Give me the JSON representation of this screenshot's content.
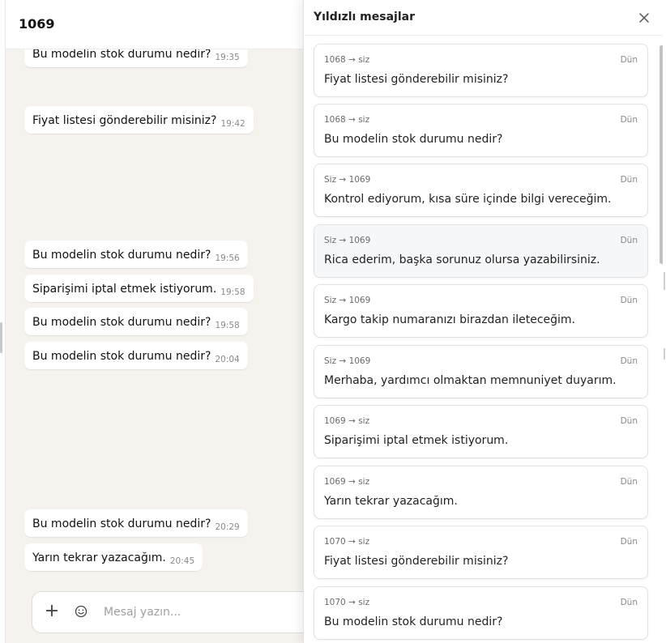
{
  "chat": {
    "title": "1069",
    "messages": [
      {
        "text": "Bu modelin stok durumu nedir?",
        "time": "19:35"
      },
      {
        "text": "Fiyat listesi gönderebilir misiniz?",
        "time": "19:42"
      },
      {
        "text": "Bu modelin stok durumu nedir?",
        "time": "19:56"
      },
      {
        "text": "Siparişimi iptal etmek istiyorum.",
        "time": "19:58"
      },
      {
        "text": "Bu modelin stok durumu nedir?",
        "time": "19:58"
      },
      {
        "text": "Bu modelin stok durumu nedir?",
        "time": "20:04"
      },
      {
        "text": "Bu modelin stok durumu nedir?",
        "time": "20:29"
      },
      {
        "text": "Yarın tekrar yazacağım.",
        "time": "20:45"
      }
    ],
    "composer": {
      "placeholder": "Mesaj yazın..."
    }
  },
  "starred_panel": {
    "title": "Yıldızlı mesajlar",
    "items": [
      {
        "route": "1068 → siz",
        "date": "Dün",
        "text": "Fiyat listesi gönderebilir misiniz?"
      },
      {
        "route": "1068 → siz",
        "date": "Dün",
        "text": "Bu modelin stok durumu nedir?"
      },
      {
        "route": "Siz → 1069",
        "date": "Dün",
        "text": "Kontrol ediyorum, kısa süre içinde bilgi vereceğim."
      },
      {
        "route": "Siz → 1069",
        "date": "Dün",
        "text": "Rica ederim, başka sorunuz olursa yazabilirsiniz."
      },
      {
        "route": "Siz → 1069",
        "date": "Dün",
        "text": "Kargo takip numaranızı birazdan ileteceğim."
      },
      {
        "route": "Siz → 1069",
        "date": "Dün",
        "text": "Merhaba, yardımcı olmaktan memnuniyet duyarım."
      },
      {
        "route": "1069 → siz",
        "date": "Dün",
        "text": "Siparişimi iptal etmek istiyorum."
      },
      {
        "route": "1069 → siz",
        "date": "Dün",
        "text": "Yarın tekrar yazacağım."
      },
      {
        "route": "1070 → siz",
        "date": "Dün",
        "text": "Fiyat listesi gönderebilir misiniz?"
      },
      {
        "route": "1070 → siz",
        "date": "Dün",
        "text": "Bu modelin stok durumu nedir?"
      }
    ]
  },
  "icons": {
    "close": "close-icon",
    "add": "plus-icon",
    "emoji": "emoji-icon"
  },
  "colors": {
    "chat_background": "#f6f3ee",
    "panel_background": "#ffffff",
    "card_border": "#e2e2e2"
  }
}
